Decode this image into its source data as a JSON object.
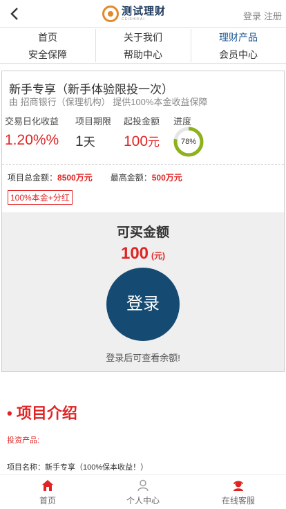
{
  "header": {
    "logo_title": "测试理财",
    "logo_sub": "CEISHIKAI",
    "login": "登录",
    "register": "注册"
  },
  "nav": {
    "items": [
      "首页",
      "关于我们",
      "理财产品",
      "安全保障",
      "帮助中心",
      "会员中心"
    ],
    "active": "理财产品"
  },
  "product": {
    "title": "新手专享（新手体验限投一次）",
    "subtitle": "由 招商银行（保理机构） 提供100%本金收益保障",
    "stats": {
      "rate_label": "交易日化收益",
      "rate_value": "1.20%%",
      "period_label": "项目期限",
      "period_num": "1",
      "period_unit": "天",
      "min_label": "起投金额",
      "min_num": "100",
      "min_unit": "元",
      "progress_label": "进度",
      "progress_text": "78%",
      "progress_value": 78
    },
    "total_label": "项目总金额：",
    "total_value": "8500万元",
    "max_label": "最高金额：",
    "max_value": "500万元",
    "tag": "100%本金+分红"
  },
  "buy": {
    "title": "可买金额",
    "amount": "100",
    "unit": "(元)",
    "login_button": "登录",
    "hint": "登录后可查看余额!"
  },
  "intro": {
    "title": "• 项目介绍",
    "line1": "投资产品:",
    "line2": "项目名称：新手专享（100%保本收益！）"
  },
  "tabbar": {
    "items": [
      "首页",
      "个人中心",
      "在线客服"
    ]
  },
  "colors": {
    "accent_red": "#e02424",
    "navy": "#154b73",
    "progress_green": "#8db21c"
  }
}
